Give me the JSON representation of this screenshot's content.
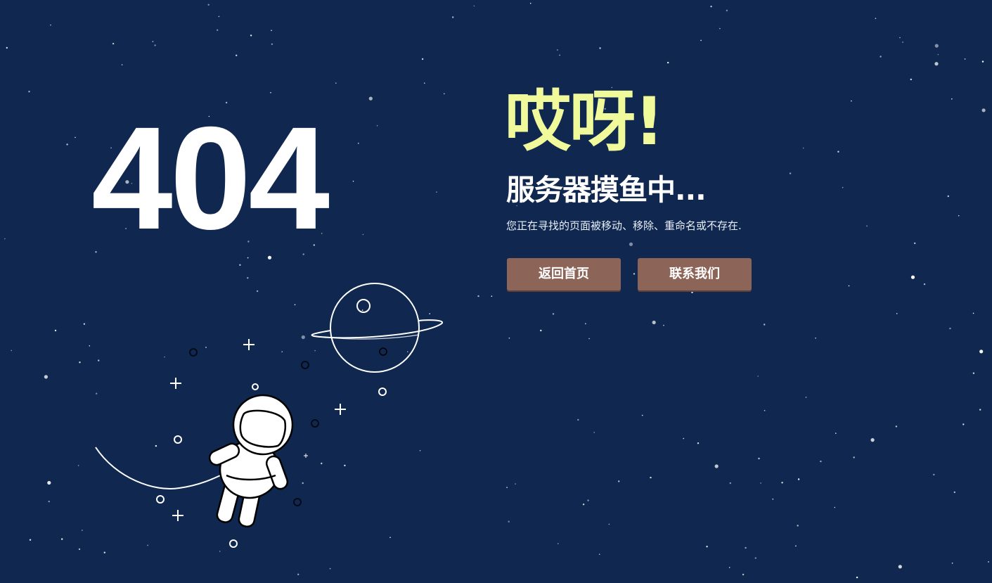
{
  "error_page": {
    "code": "404",
    "headline": "哎呀!",
    "subheadline": "服务器摸鱼中...",
    "description": "您正在寻找的页面被移动、移除、重命名或不存在."
  },
  "actions": {
    "home_label": "返回首页",
    "contact_label": "联系我们"
  },
  "colors": {
    "background": "#10284f",
    "headline": "#f1fa9b",
    "button": "#8c6458",
    "text": "#ffffff"
  },
  "icons": {
    "illustration": "astronaut-floating-icon",
    "planet": "ringed-planet-icon"
  }
}
